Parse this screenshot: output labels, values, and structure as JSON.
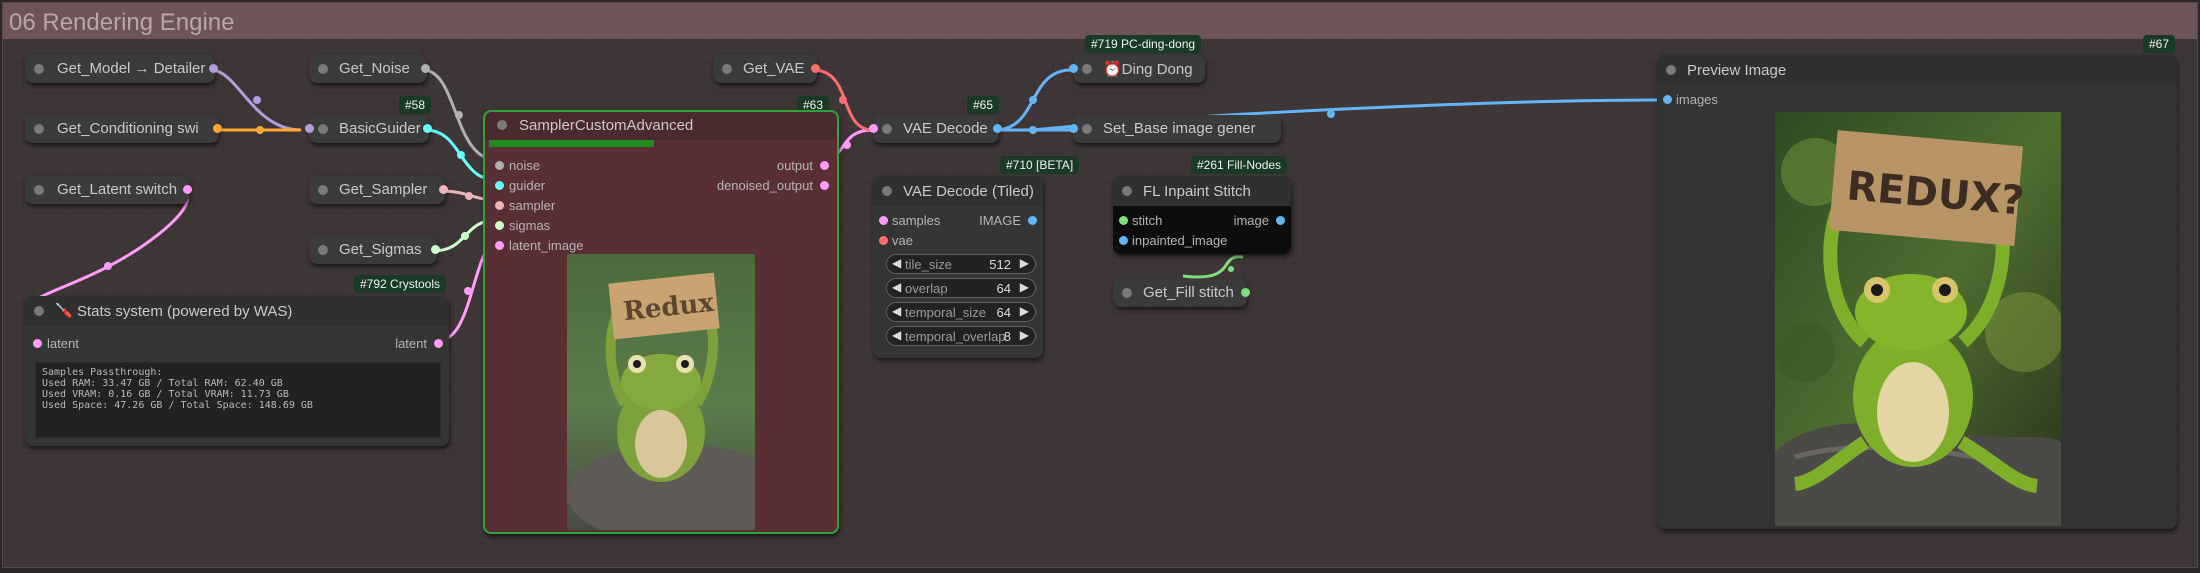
{
  "group": {
    "title": "06 Rendering Engine"
  },
  "nodes": {
    "get_model": {
      "title": "Get_Model → Detailer"
    },
    "get_conditioning": {
      "title": "Get_Conditioning swi"
    },
    "get_latent": {
      "title": "Get_Latent switch"
    },
    "get_noise": {
      "title": "Get_Noise"
    },
    "basic_guider": {
      "title": "BasicGuider",
      "badge": "#58"
    },
    "get_sampler": {
      "title": "Get_Sampler"
    },
    "get_sigmas": {
      "title": "Get_Sigmas",
      "badge": "#792 Crystools"
    },
    "stats": {
      "icon": "🪛",
      "title": "Stats system (powered by WAS)",
      "input": "latent",
      "output": "latent",
      "text": "Samples Passthrough:\nUsed RAM: 33.47 GB / Total RAM: 62.40 GB\nUsed VRAM: 0.16 GB / Total VRAM: 11.73 GB\nUsed Space: 47.26 GB / Total Space: 148.69 GB"
    },
    "sampler": {
      "title": "SamplerCustomAdvanced",
      "badge": "#63",
      "progress": 0.48,
      "inputs": [
        "noise",
        "guider",
        "sampler",
        "sigmas",
        "latent_image"
      ],
      "outputs": [
        "output",
        "denoised_output"
      ],
      "preview_sign": "Redux"
    },
    "get_vae": {
      "title": "Get_VAE"
    },
    "vae_decode": {
      "title": "VAE Decode",
      "badge": "#65"
    },
    "vae_tiled": {
      "title": "VAE Decode (Tiled)",
      "badge": "#710 [BETA]",
      "inputs": [
        "samples",
        "vae"
      ],
      "output": "IMAGE",
      "widgets": [
        {
          "label": "tile_size",
          "value": "512"
        },
        {
          "label": "overlap",
          "value": "64"
        },
        {
          "label": "temporal_size",
          "value": "64"
        },
        {
          "label": "temporal_overlap",
          "value": "8"
        }
      ]
    },
    "ding": {
      "title": "⏰Ding Dong",
      "badge": "#719 PC-ding-dong"
    },
    "set_base": {
      "title": "Set_Base image gener"
    },
    "inpaint": {
      "title": "FL Inpaint Stitch",
      "badge": "#261 Fill-Nodes",
      "inputs": [
        "stitch",
        "inpainted_image"
      ],
      "output": "image"
    },
    "get_fill": {
      "title": "Get_Fill stitch"
    },
    "preview": {
      "title": "Preview Image",
      "badge": "#67",
      "input": "images",
      "sign": "REDUX?"
    }
  },
  "colors": {
    "model": "#b39ddb",
    "conditioning": "#ffa931",
    "latent": "#ff9cf9",
    "noise": "#b0b0b0",
    "guider": "#66ffff",
    "sampler": "#ecb4b4",
    "sigmas": "#cdffcd",
    "vae": "#ff6e6e",
    "image": "#64b5f6",
    "stitch": "#7fde7f",
    "group_header": "#6d5459",
    "sampler_border": "#2fa33b"
  }
}
